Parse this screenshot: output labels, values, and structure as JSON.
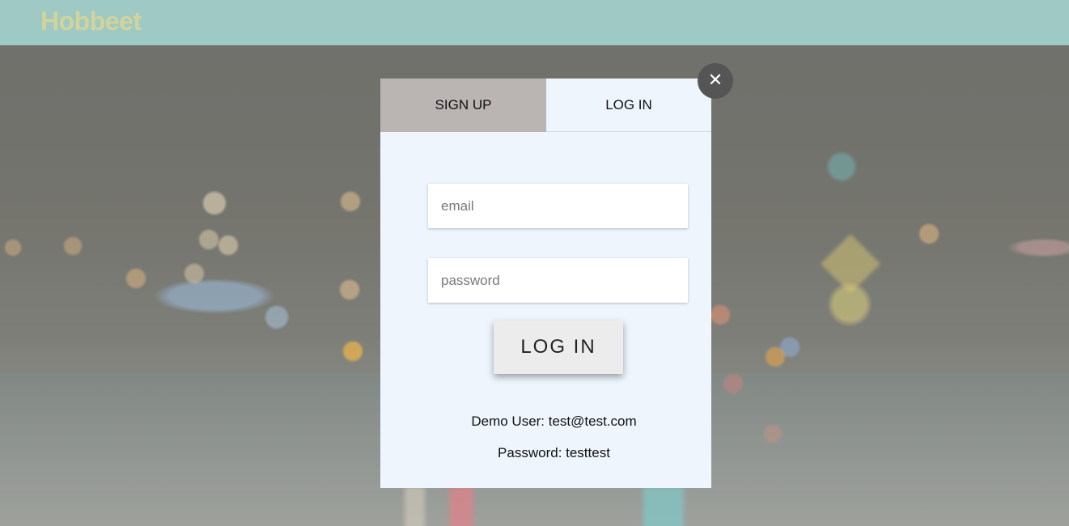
{
  "header": {
    "logo": "Hobbeet",
    "background_color": "#9ec9c5",
    "logo_color": "#d2d49a"
  },
  "modal": {
    "tabs": [
      {
        "label": "SIGN UP",
        "active": false
      },
      {
        "label": "LOG IN",
        "active": true
      }
    ],
    "email_placeholder": "email",
    "password_placeholder": "password",
    "submit_label": "LOG IN",
    "demo_user": "Demo User: test@test.com",
    "demo_password": "Password: testtest",
    "close_icon": "close-icon",
    "close_glyph": "✕"
  }
}
